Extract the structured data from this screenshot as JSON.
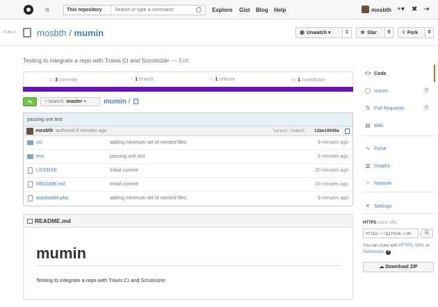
{
  "header": {
    "search_scope": "This repository",
    "search_placeholder": "Search or type a command",
    "search_help": "?",
    "nav": [
      "Explore",
      "Gist",
      "Blog",
      "Help"
    ],
    "username": "mosbth",
    "icons": [
      "github-logo-icon",
      "notification-dot-icon",
      "plus-icon",
      "tools-icon",
      "sign-out-icon"
    ]
  },
  "repo": {
    "visibility": "PUBLIC",
    "owner": "mosbth",
    "separator": "/",
    "name": "mumin",
    "unwatch_label": "Unwatch",
    "watch_count": "1",
    "star_label": "Star",
    "star_count": "0",
    "fork_label": "Fork",
    "fork_count": "0",
    "description": "Testing to integrate a repo with Travis CI and Scrutinizer",
    "edit_label": "— Edit"
  },
  "summary": {
    "commits_count": "3",
    "commits_label": "commits",
    "branch_count": "1",
    "branch_label": "branch",
    "release_count": "1",
    "release_label": "release",
    "contributor_count": "1",
    "contributor_label": "contributor",
    "language_color": "#6f0dbf"
  },
  "filenav": {
    "branch_prefix": "branch:",
    "branch": "master",
    "repo_crumb": "mumin",
    "crumb_sep": "/",
    "add_file": "+"
  },
  "last_commit": {
    "message": "passing unit test",
    "author": "mosbth",
    "authored": "authored 8 minutes ago",
    "latest_label": "latest commit",
    "sha": "12be10046e"
  },
  "files": [
    {
      "type": "dir",
      "name": "src",
      "message": "adding minimum set of needed files",
      "age": "9 minutes ago"
    },
    {
      "type": "dir",
      "name": "test",
      "message": "passing unit test",
      "age": "8 minutes ago"
    },
    {
      "type": "file",
      "name": "LICENSE",
      "message": "Initial commit",
      "age": "20 minutes ago"
    },
    {
      "type": "file",
      "name": "README.md",
      "message": "Initial commit",
      "age": "20 minutes ago"
    },
    {
      "type": "file",
      "name": "autoloader.php",
      "message": "adding minimum set of needed files",
      "age": "9 minutes ago"
    }
  ],
  "readme": {
    "filename": "README.md",
    "heading": "mumin",
    "body": "Testing to integrate a repo with Travis CI and Scrutinizer"
  },
  "sidebar": {
    "items": [
      {
        "label": "Code",
        "icon": "<>",
        "count": ""
      },
      {
        "label": "Issues",
        "icon": "◯",
        "count": "0"
      },
      {
        "label": "Pull Requests",
        "icon": "⇅",
        "count": "0"
      },
      {
        "label": "Wiki",
        "icon": "▤",
        "count": ""
      },
      {
        "label": "Pulse",
        "icon": "∿",
        "count": ""
      },
      {
        "label": "Graphs",
        "icon": "▥",
        "count": ""
      },
      {
        "label": "Network",
        "icon": "⑂",
        "count": ""
      },
      {
        "label": "Settings",
        "icon": "✕",
        "count": ""
      }
    ],
    "clone_protocol": "HTTPS",
    "clone_label": "clone URL",
    "clone_url": "https://github.com",
    "clone_help_prefix": "You can clone with",
    "clone_https": "HTTPS",
    "clone_ssh": "SSH",
    "clone_or": ", or",
    "clone_subversion": "Subversion",
    "download_label": "Download ZIP"
  }
}
